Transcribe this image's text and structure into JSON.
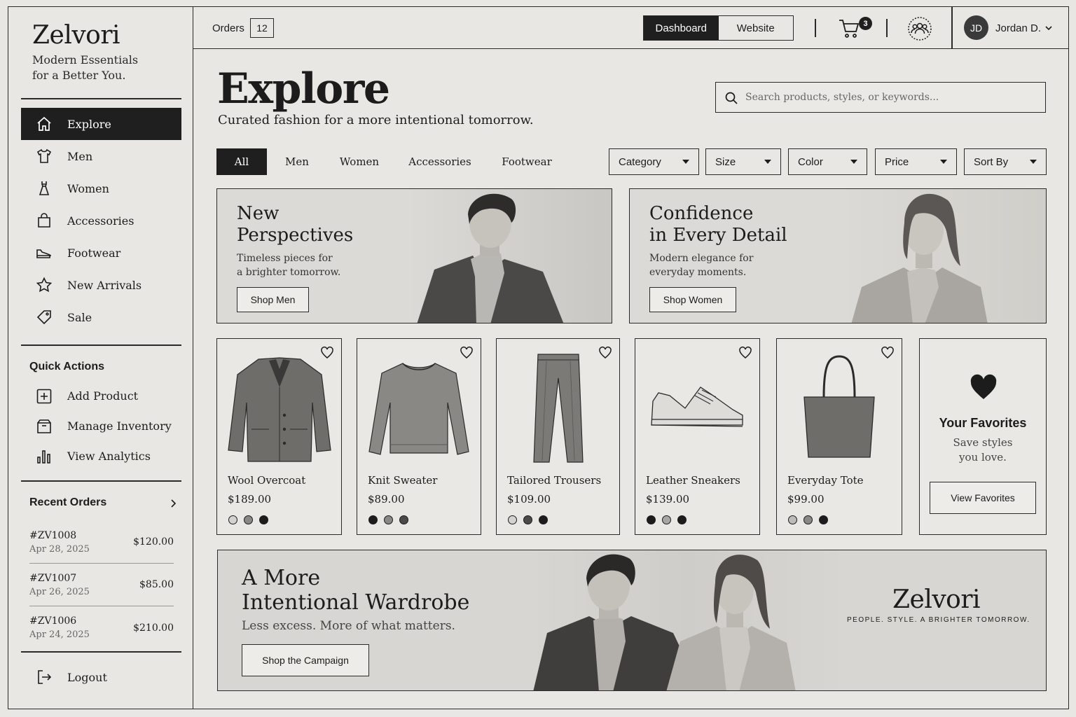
{
  "brand": {
    "name": "Zelvori",
    "tagline_line1": "Modern Essentials",
    "tagline_line2": "for a Better You."
  },
  "sidebar": {
    "items": [
      {
        "label": "Explore",
        "icon": "home-icon",
        "active": true
      },
      {
        "label": "Men",
        "icon": "shirt-icon"
      },
      {
        "label": "Women",
        "icon": "dress-icon"
      },
      {
        "label": "Accessories",
        "icon": "bag-icon"
      },
      {
        "label": "Footwear",
        "icon": "shoe-icon"
      },
      {
        "label": "New Arrivals",
        "icon": "star-icon"
      },
      {
        "label": "Sale",
        "icon": "tag-icon"
      }
    ],
    "quick_actions_title": "Quick Actions",
    "quick_actions": [
      {
        "label": "Add Product",
        "icon": "plus-square-icon"
      },
      {
        "label": "Manage Inventory",
        "icon": "box-icon"
      },
      {
        "label": "View Analytics",
        "icon": "bar-chart-icon"
      }
    ],
    "recent_orders_title": "Recent Orders",
    "recent_orders": [
      {
        "id": "#ZV1008",
        "date": "Apr 28, 2025",
        "amount": "$120.00"
      },
      {
        "id": "#ZV1007",
        "date": "Apr 26, 2025",
        "amount": "$85.00"
      },
      {
        "id": "#ZV1006",
        "date": "Apr 24, 2025",
        "amount": "$210.00"
      }
    ],
    "logout_label": "Logout"
  },
  "topbar": {
    "orders_label": "Orders",
    "orders_count": "12",
    "toggle": [
      "Dashboard",
      "Website"
    ],
    "cart_count": "3",
    "user_initials": "JD",
    "user_name": "Jordan D."
  },
  "main": {
    "title": "Explore",
    "subtitle": "Curated fashion for a more intentional tomorrow.",
    "search_placeholder": "Search products, styles, or keywords...",
    "tabs": [
      "All",
      "Men",
      "Women",
      "Accessories",
      "Footwear"
    ],
    "filters": [
      "Category",
      "Size",
      "Color",
      "Price",
      "Sort By"
    ]
  },
  "banners": [
    {
      "title1": "New",
      "title2": "Perspectives",
      "sub1": "Timeless pieces for",
      "sub2": "a brighter tomorrow.",
      "button": "Shop Men"
    },
    {
      "title1": "Confidence",
      "title2": "in Every Detail",
      "sub1": "Modern elegance for",
      "sub2": "everyday moments.",
      "button": "Shop Women"
    }
  ],
  "products": [
    {
      "name": "Wool Overcoat",
      "price": "$189.00",
      "swatches": [
        "#d4d2ce",
        "#8a8885",
        "#1c1c1c"
      ]
    },
    {
      "name": "Knit Sweater",
      "price": "$89.00",
      "swatches": [
        "#1c1c1c",
        "#8a8885",
        "#4a4a4a"
      ]
    },
    {
      "name": "Tailored Trousers",
      "price": "$109.00",
      "swatches": [
        "#d4d2ce",
        "#4a4a4a",
        "#1c1c1c"
      ]
    },
    {
      "name": "Leather Sneakers",
      "price": "$139.00",
      "swatches": [
        "#1c1c1c",
        "#a8a6a2",
        "#1c1c1c"
      ]
    },
    {
      "name": "Everyday Tote",
      "price": "$99.00",
      "swatches": [
        "#bdbbb7",
        "#8a8885",
        "#1c1c1c"
      ]
    }
  ],
  "favorites": {
    "title": "Your Favorites",
    "sub1": "Save styles",
    "sub2": "you love.",
    "button": "View Favorites"
  },
  "campaign": {
    "title1": "A More",
    "title2": "Intentional Wardrobe",
    "sub": "Less excess. More of what matters.",
    "button": "Shop the Campaign",
    "brand": "Zelvori",
    "brand_tag": "PEOPLE. STYLE. A BRIGHTER TOMORROW."
  },
  "colors": {
    "ink": "#1f1f1f",
    "paper": "#e9e7e3",
    "line": "#2a2a2a"
  }
}
